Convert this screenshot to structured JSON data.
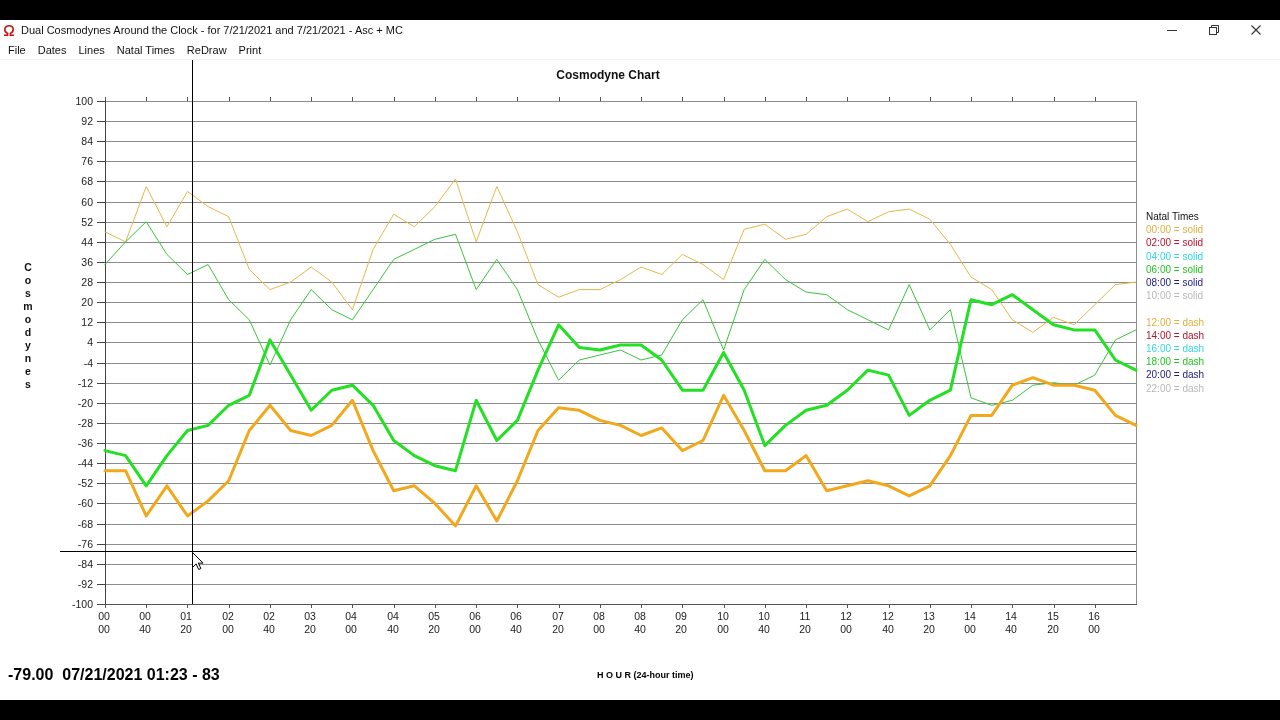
{
  "window": {
    "title": "Dual Cosmodynes Around the Clock - for 7/21/2021 and 7/21/2021 - Asc + MC"
  },
  "menu": [
    "File",
    "Dates",
    "Lines",
    "Natal Times",
    "ReDraw",
    "Print"
  ],
  "chart": {
    "chart_data": {
      "type": "line",
      "title": "Cosmodyne Chart",
      "xlabel": "H O U R (24-hour time)",
      "ylabel": "Cosmodynes",
      "categories": [
        "00 00",
        null,
        "00 40",
        null,
        "01 20",
        null,
        "02 00",
        null,
        "02 40",
        null,
        "03 20",
        null,
        "04 00",
        null,
        "04 40",
        null,
        "05 20",
        null,
        "06 00",
        null,
        "06 40",
        null,
        "07 20",
        null,
        "08 00",
        null,
        "08 40",
        null,
        "09 20",
        null,
        "10 00",
        null,
        "10 40",
        null,
        "11 20",
        null,
        "12 00",
        null,
        "12 40",
        null,
        "13 20",
        null,
        "14 00",
        null,
        "14 40",
        null,
        "15 20",
        null,
        "16 00",
        null,
        null
      ],
      "ylim": [
        -100,
        100
      ],
      "yticks": [
        100,
        92,
        84,
        76,
        68,
        60,
        52,
        44,
        36,
        28,
        20,
        12,
        4,
        -4,
        -12,
        -20,
        -28,
        -36,
        -44,
        -52,
        -60,
        -68,
        -76,
        -84,
        -92,
        -100
      ],
      "grid": true,
      "series": [
        {
          "color": "#e6b84a",
          "values": [
            48,
            44,
            66,
            50,
            64,
            58,
            54,
            33,
            25,
            28,
            34,
            28,
            17,
            41,
            55,
            50,
            58,
            69,
            44,
            66,
            48,
            27,
            22,
            25,
            25,
            29,
            34,
            31,
            39,
            35,
            29,
            49,
            51,
            45,
            47,
            54,
            57,
            52,
            56,
            57,
            53,
            43,
            30,
            25,
            13,
            8,
            14,
            11,
            19,
            27,
            28
          ]
        },
        {
          "color": "#3cc43c",
          "values": [
            35,
            44,
            52,
            39,
            31,
            35,
            21,
            13,
            -5,
            13,
            25,
            17,
            13,
            25,
            37,
            41,
            45,
            47,
            25,
            37,
            25,
            5,
            -11,
            -3,
            -1,
            1,
            -3,
            -1,
            13,
            21,
            1,
            25,
            37,
            29,
            24,
            23,
            17,
            13,
            9,
            27,
            9,
            17,
            -18,
            -21,
            -19,
            -13,
            -12,
            -13,
            -9,
            5,
            9
          ]
        },
        {
          "color": "#22e022",
          "values": [
            -39,
            -41,
            -53,
            -41,
            -31,
            -29,
            -21,
            -17,
            5,
            -9,
            -23,
            -15,
            -13,
            -21,
            -35,
            -41,
            -45,
            -47,
            -19,
            -35,
            -27,
            -7,
            11,
            2,
            1,
            3,
            3,
            -3,
            -15,
            -15,
            0,
            -15,
            -37,
            -29,
            -23,
            -21,
            -15,
            -7,
            -9,
            -25,
            -19,
            -15,
            21,
            19,
            23,
            17,
            11,
            9,
            9,
            -3,
            -7
          ]
        },
        {
          "color": "#f2a81c",
          "values": [
            -47,
            -47,
            -65,
            -53,
            -65,
            -59,
            -51,
            -31,
            -21,
            -31,
            -33,
            -29,
            -19,
            -39,
            -55,
            -53,
            -60,
            -69,
            -53,
            -67,
            -51,
            -31,
            -22,
            -23,
            -27,
            -29,
            -33,
            -30,
            -39,
            -35,
            -17,
            -31,
            -47,
            -47,
            -41,
            -55,
            -53,
            -51,
            -53,
            -57,
            -53,
            -41,
            -25,
            -25,
            -13,
            -10,
            -13,
            -13,
            -15,
            -25,
            -29
          ]
        }
      ],
      "ref_lines": [
        {
          "axis": "y",
          "value": -79
        }
      ]
    },
    "line_styles": [
      {
        "kind": "thin"
      },
      {
        "kind": "thin"
      },
      {
        "kind": "thick"
      },
      {
        "kind": "thick"
      }
    ],
    "legend": {
      "title": "Natal Times",
      "groups": [
        {
          "items": [
            {
              "label": "00:00 = solid",
              "color": "#e0b040"
            },
            {
              "label": "02:00 = solid",
              "color": "#c0102a"
            },
            {
              "label": "04:00 = solid",
              "color": "#30d8e8"
            },
            {
              "label": "06:00 = solid",
              "color": "#20c820"
            },
            {
              "label": "08:00 = solid",
              "color": "#1a1a80"
            },
            {
              "label": "10:00 = solid",
              "color": "#b8b8b8"
            }
          ]
        },
        {
          "items": [
            {
              "label": "12:00 = dash",
              "color": "#e0b040"
            },
            {
              "label": "14:00 = dash",
              "color": "#c0102a"
            },
            {
              "label": "16:00 = dash",
              "color": "#30d8e8"
            },
            {
              "label": "18:00 = dash",
              "color": "#20c820"
            },
            {
              "label": "20:00 = dash",
              "color": "#1a1a80"
            },
            {
              "label": "22:00 = dash",
              "color": "#b8b8b8"
            }
          ]
        }
      ]
    }
  },
  "readout": "-79.00  07/21/2021 01:23 - 83"
}
